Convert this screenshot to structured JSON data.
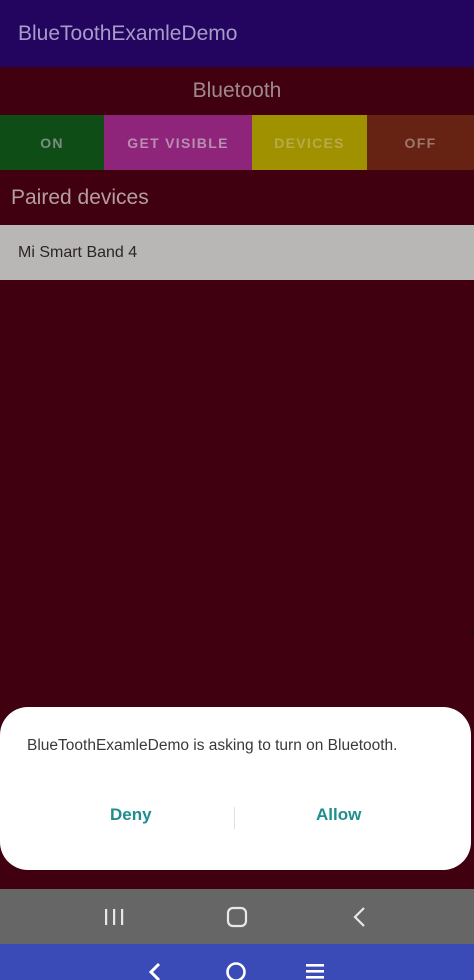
{
  "app_bar": {
    "title": "BlueToothExamleDemo"
  },
  "main": {
    "section_title": "Bluetooth",
    "buttons": [
      {
        "label": "ON",
        "bg": "#0f4d16",
        "fg": "#7b8e7d"
      },
      {
        "label": "GET VISIBLE",
        "bg": "#8e257a",
        "fg": "#b98eb1"
      },
      {
        "label": "DEVICES",
        "bg": "#9f9100",
        "fg": "#b7aa4b"
      },
      {
        "label": "OFF",
        "bg": "#662313",
        "fg": "#9d776d"
      }
    ],
    "paired_label": "Paired devices",
    "devices": [
      "Mi Smart Band 4"
    ]
  },
  "dialog": {
    "message": "BlueToothExamleDemo is asking to turn on Bluetooth.",
    "deny_label": "Deny",
    "allow_label": "Allow"
  },
  "nav": {
    "icons": [
      "recent-apps-icon",
      "home-icon",
      "back-icon"
    ]
  },
  "bottom_strip": {
    "icons": [
      "back-chevron-icon",
      "home-circle-icon",
      "menu-icon"
    ]
  },
  "colors": {
    "app_bar": "#230560",
    "content_bg": "#41000f",
    "accent": "#1e8e8e"
  }
}
